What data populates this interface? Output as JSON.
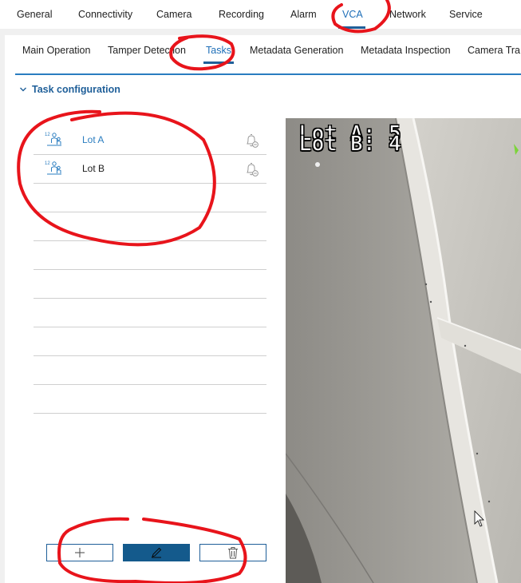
{
  "topnav": {
    "tabs": [
      {
        "label": "General"
      },
      {
        "label": "Connectivity"
      },
      {
        "label": "Camera"
      },
      {
        "label": "Recording"
      },
      {
        "label": "Alarm"
      },
      {
        "label": "VCA"
      },
      {
        "label": "Network"
      },
      {
        "label": "Service"
      }
    ],
    "active": "VCA"
  },
  "subnav": {
    "tabs": [
      {
        "label": "Main Operation"
      },
      {
        "label": "Tamper Detection"
      },
      {
        "label": "Tasks"
      },
      {
        "label": "Metadata Generation"
      },
      {
        "label": "Metadata Inspection"
      },
      {
        "label": "Camera Tra"
      }
    ],
    "active": "Tasks"
  },
  "section": {
    "title": "Task configuration",
    "icon": "chevron-down-icon"
  },
  "tasks": [
    {
      "name": "Lot A",
      "icon": "people-counting-icon",
      "alarm_icon": "bell-muted-icon",
      "selected": true
    },
    {
      "name": "Lot B",
      "icon": "people-counting-icon",
      "alarm_icon": "bell-muted-icon",
      "selected": false
    }
  ],
  "task_icon_label": "12",
  "buttons": {
    "add_icon": "plus-icon",
    "edit_icon": "pencil-icon",
    "delete_icon": "trash-icon"
  },
  "video": {
    "overlay_line1": "Lot A: 5",
    "overlay_line2": "Lot B: 4"
  },
  "colors": {
    "accent": "#1f5f99",
    "link": "#2a7dc0",
    "primary_button": "#145a8c",
    "annotation": "#e8141b"
  }
}
